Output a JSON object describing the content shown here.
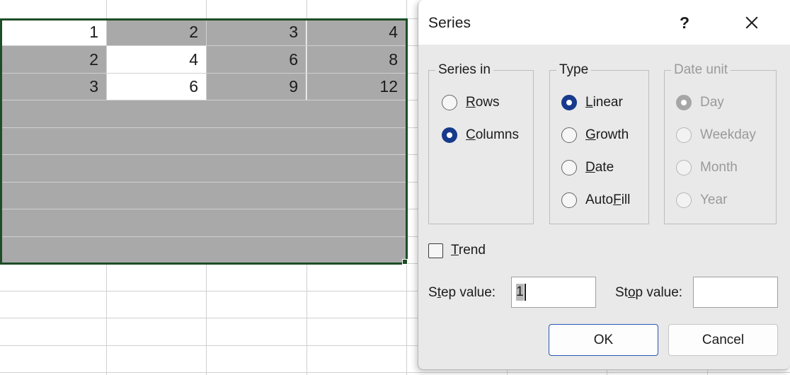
{
  "spreadsheet": {
    "rows": [
      [
        "1",
        "2",
        "3",
        "4"
      ],
      [
        "2",
        "4",
        "6",
        "8"
      ],
      [
        "3",
        "6",
        "9",
        "12"
      ]
    ],
    "active_cell_value": "1",
    "selection_color": "#1d4d26",
    "selected_fill": "#a9a9a9"
  },
  "dialog": {
    "title": "Series",
    "help_glyph": "?",
    "close_icon": "close-icon",
    "series_in": {
      "legend": "Series in",
      "options": [
        {
          "label_pre": "",
          "accel": "R",
          "label_post": "ows",
          "checked": false
        },
        {
          "label_pre": "",
          "accel": "C",
          "label_post": "olumns",
          "checked": true
        }
      ]
    },
    "type": {
      "legend": "Type",
      "options": [
        {
          "label_pre": "",
          "accel": "L",
          "label_post": "inear",
          "checked": true
        },
        {
          "label_pre": "",
          "accel": "G",
          "label_post": "rowth",
          "checked": false
        },
        {
          "label_pre": "",
          "accel": "D",
          "label_post": "ate",
          "checked": false
        },
        {
          "label_pre": "Auto",
          "accel": "F",
          "label_post": "ill",
          "checked": false
        }
      ]
    },
    "date_unit": {
      "legend": "Date unit",
      "disabled": true,
      "options": [
        {
          "label_pre": "Day",
          "accel": "",
          "label_post": "",
          "checked": true
        },
        {
          "label_pre": "Weekday",
          "accel": "",
          "label_post": "",
          "checked": false
        },
        {
          "label_pre": "Month",
          "accel": "",
          "label_post": "",
          "checked": false
        },
        {
          "label_pre": "Year",
          "accel": "",
          "label_post": "",
          "checked": false
        }
      ]
    },
    "trend": {
      "label_pre": "",
      "accel": "T",
      "label_post": "rend",
      "checked": false
    },
    "step_value": {
      "label_pre": "S",
      "accel_first": "t",
      "label_mid": "ep value:",
      "value": "1",
      "selected": true
    },
    "stop_value": {
      "label_pre": "St",
      "accel": "o",
      "label_post": "p value:",
      "value": ""
    },
    "buttons": {
      "ok": "OK",
      "cancel": "Cancel"
    },
    "accent_color": "#163a8c",
    "default_button_border": "#2a57b5"
  }
}
